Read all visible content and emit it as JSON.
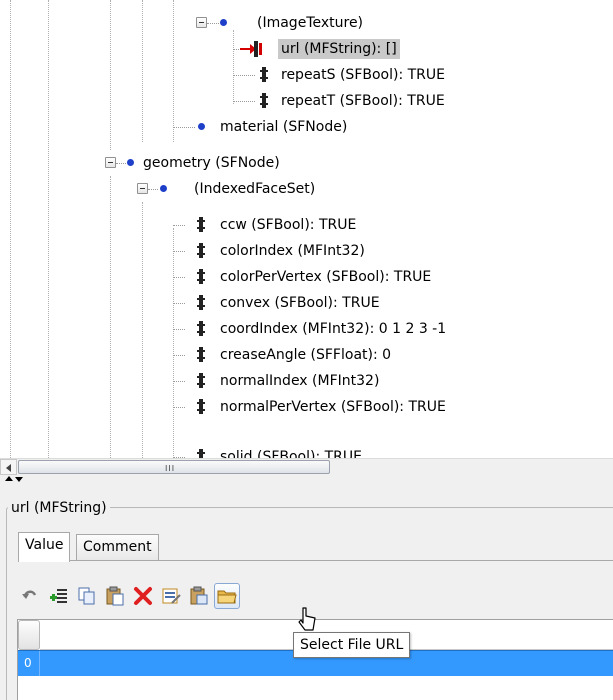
{
  "tree": {
    "rows": [
      {
        "label": "(ImageTexture)"
      },
      {
        "label": "url (MFString): []",
        "selected": true
      },
      {
        "label": "repeatS (SFBool): TRUE"
      },
      {
        "label": "repeatT (SFBool): TRUE"
      },
      {
        "label": "material (SFNode)"
      },
      {
        "label": "geometry (SFNode)"
      },
      {
        "label": "(IndexedFaceSet)"
      },
      {
        "label": "ccw (SFBool): TRUE"
      },
      {
        "label": "colorIndex (MFInt32)"
      },
      {
        "label": "colorPerVertex (SFBool): TRUE"
      },
      {
        "label": "convex (SFBool): TRUE"
      },
      {
        "label": "coordIndex (MFInt32): 0  1  2  3 -1"
      },
      {
        "label": "creaseAngle (SFFloat): 0"
      },
      {
        "label": "normalIndex (MFInt32)"
      },
      {
        "label": "normalPerVertex (SFBool): TRUE"
      },
      {
        "label": "solid (SFBool): TRUE"
      }
    ]
  },
  "scrollbar": {
    "grip": "III"
  },
  "panel": {
    "title": "url (MFString)",
    "tabs": [
      {
        "label": "Value",
        "active": true
      },
      {
        "label": "Comment",
        "active": false
      }
    ],
    "toolbar_icons": [
      "undo-icon",
      "add-rows-icon",
      "copy-icon",
      "paste-icon",
      "delete-icon",
      "edit-icon",
      "paste-special-icon",
      "select-file-url-icon"
    ],
    "grid": {
      "rows": [
        {
          "index": "0",
          "value": ""
        }
      ]
    },
    "tooltip": "Select File URL"
  },
  "colors": {
    "selection_blue": "#3399ff",
    "node_dot_blue": "#1e3fc8",
    "delete_red": "#e02020",
    "tree_selection_gray": "#c9c9c9"
  }
}
